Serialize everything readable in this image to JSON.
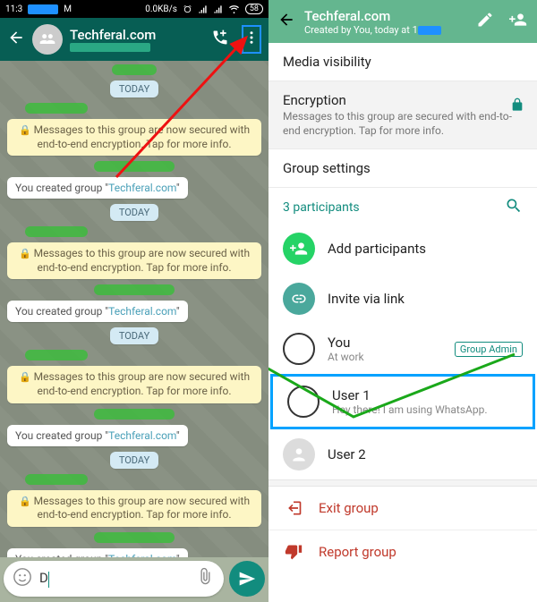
{
  "statusbar": {
    "time": "11:3",
    "net": "0.0KB/s",
    "battery": "58"
  },
  "chat": {
    "title": "Techferal.com",
    "date_label": "TODAY",
    "encryption_notice": "Messages to this group are now secured with end-to-end encryption. Tap for more info.",
    "created_message": "You created group \"Techferal.com\"",
    "input_value": "D"
  },
  "info": {
    "title": "Techferal.com",
    "subtitle": "Created by You, today at 1",
    "media_visibility": "Media visibility",
    "encryption_title": "Encryption",
    "encryption_sub": "Messages to this group are secured with end-to-end encryption. Tap for more info.",
    "group_settings": "Group settings",
    "participants_count": "3 participants",
    "add": "Add participants",
    "invite": "Invite via link",
    "you": {
      "name": "You",
      "status": "At work",
      "badge": "Group Admin"
    },
    "user1": {
      "name": "User 1",
      "status": "Hey there! I am using WhatsApp."
    },
    "user2": {
      "name": "User 2"
    },
    "exit": "Exit group",
    "report": "Report group"
  }
}
